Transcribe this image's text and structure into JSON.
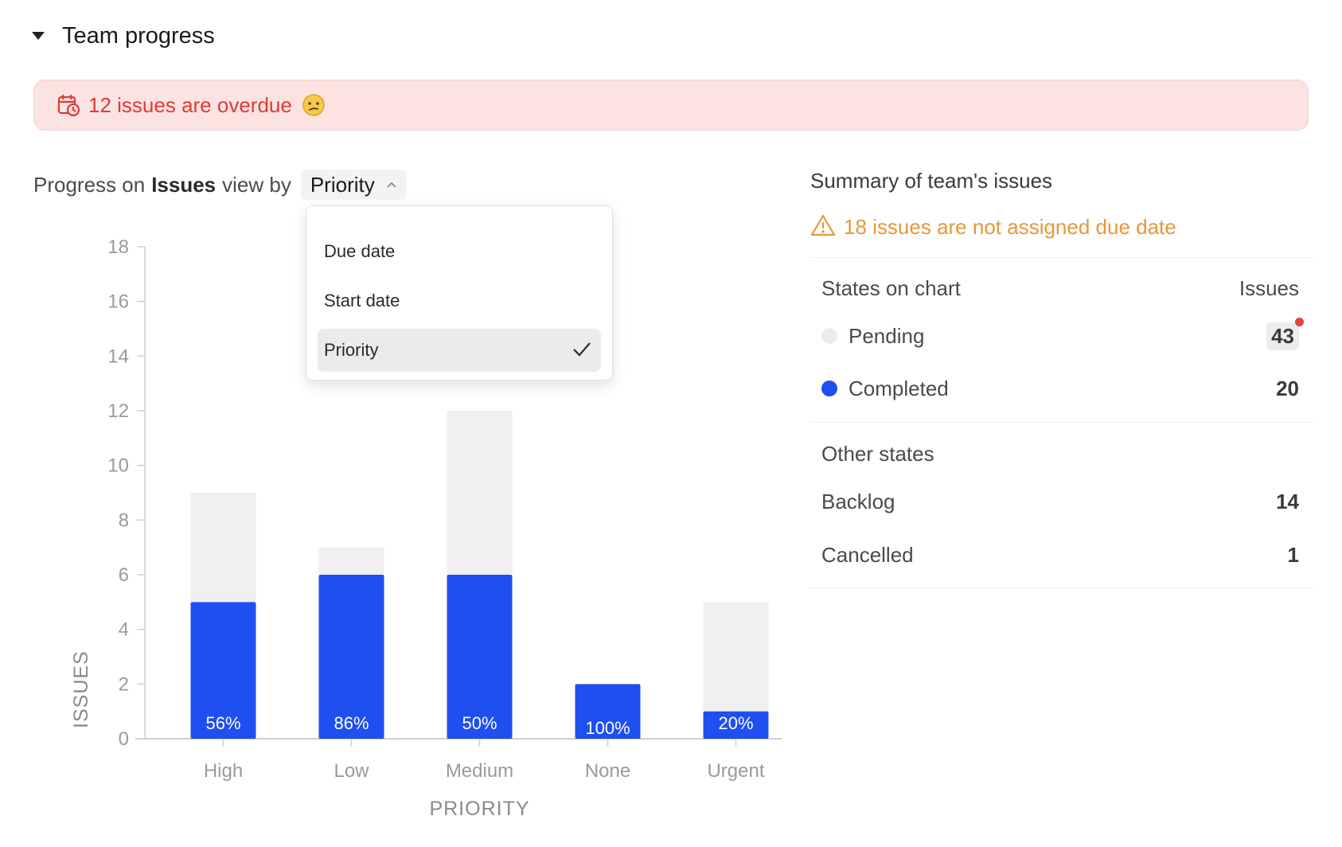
{
  "section": {
    "title": "Team progress"
  },
  "overdue": {
    "text": "12 issues are overdue"
  },
  "progress": {
    "prefix": "Progress on",
    "entity": "Issues",
    "view_by": "view by",
    "selected": "Priority"
  },
  "dropdown": {
    "options": [
      "Due date",
      "Start date",
      "Priority"
    ],
    "selected_index": 2
  },
  "colors": {
    "completed": "#1f4ff0",
    "pending": "#efefef",
    "overdue": "#de3b36",
    "warning": "#e8963a"
  },
  "chart_data": {
    "type": "bar",
    "stacked": true,
    "categories": [
      "High",
      "Low",
      "Medium",
      "None",
      "Urgent"
    ],
    "series": [
      {
        "values": [
          5,
          6,
          6,
          2,
          1
        ]
      },
      {
        "values": [
          4,
          1,
          6,
          0,
          4
        ]
      }
    ],
    "percent_labels": [
      "56%",
      "86%",
      "50%",
      "100%",
      "20%"
    ],
    "xlabel": "PRIORITY",
    "ylabel": "ISSUES",
    "ylim": [
      0,
      18
    ],
    "yticks": [
      0,
      2,
      4,
      6,
      8,
      10,
      12,
      14,
      16,
      18
    ],
    "grid": false
  },
  "summary": {
    "title": "Summary of team's issues",
    "unassigned": "18 issues are not assigned due date",
    "states_header": "States on chart",
    "issues_header": "Issues",
    "states_on_chart": [
      {
        "label": "Pending",
        "count": "43"
      },
      {
        "label": "Completed",
        "count": "20"
      }
    ],
    "other_header": "Other states",
    "other_states": [
      {
        "label": "Backlog",
        "count": "14"
      },
      {
        "label": "Cancelled",
        "count": "1"
      }
    ]
  }
}
